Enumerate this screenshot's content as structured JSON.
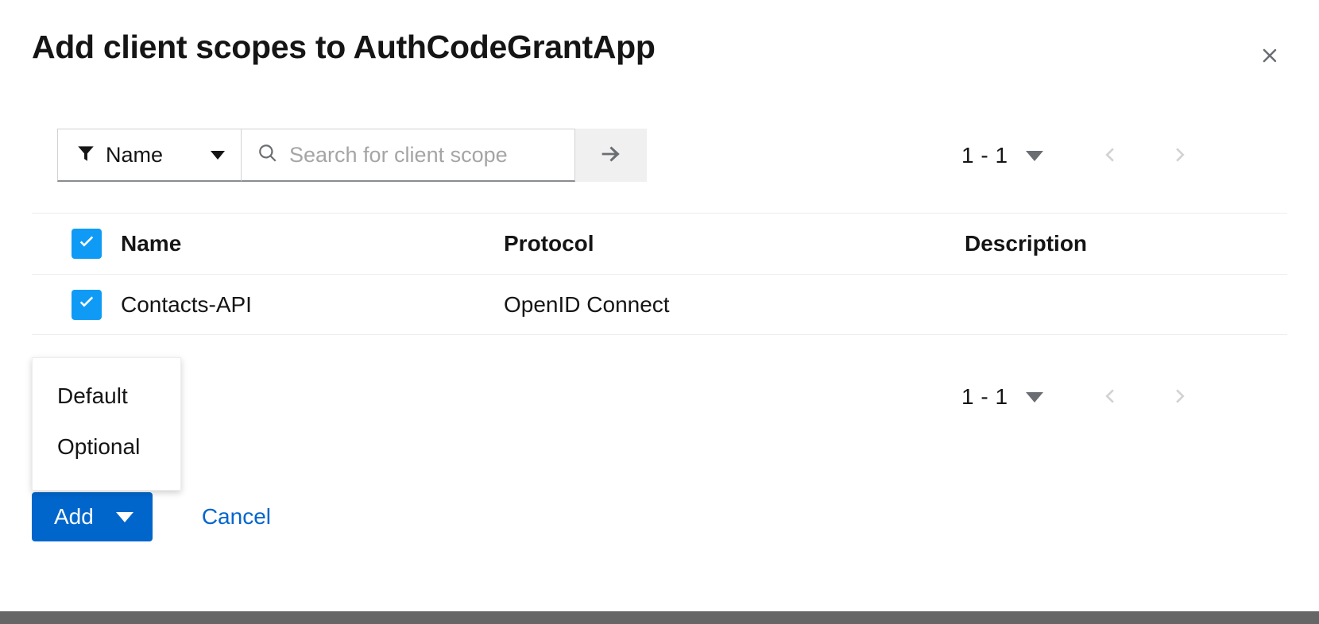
{
  "dialog": {
    "title": "Add client scopes to AuthCodeGrantApp",
    "close_icon": "close-icon"
  },
  "toolbar": {
    "filter": {
      "icon": "filter-funnel-icon",
      "label": "Name",
      "caret_icon": "chevron-down-icon"
    },
    "search": {
      "icon": "search-icon",
      "value": "",
      "placeholder": "Search for client scope",
      "submit_icon": "arrow-right-icon"
    }
  },
  "pagination_top": {
    "range": "1 - 1",
    "caret_icon": "chevron-down-icon",
    "prev_icon": "chevron-left-icon",
    "next_icon": "chevron-right-icon"
  },
  "pagination_bottom": {
    "range": "1 - 1",
    "caret_icon": "chevron-down-icon",
    "prev_icon": "chevron-left-icon",
    "next_icon": "chevron-right-icon"
  },
  "table": {
    "select_all_checked": true,
    "columns": [
      "Name",
      "Protocol",
      "Description"
    ],
    "rows": [
      {
        "checked": true,
        "name": "Contacts-API",
        "protocol": "OpenID Connect",
        "description": ""
      }
    ]
  },
  "dropdown": {
    "open": true,
    "items": [
      "Default",
      "Optional"
    ]
  },
  "actions": {
    "add_label": "Add",
    "add_caret_icon": "caret-down-icon",
    "cancel_label": "Cancel"
  },
  "colors": {
    "primary_blue": "#0066cc",
    "checkbox_blue": "#0f9bf5",
    "link_blue": "#0066cc",
    "muted_gray": "#6a6e73",
    "bottom_bar": "#666666"
  }
}
